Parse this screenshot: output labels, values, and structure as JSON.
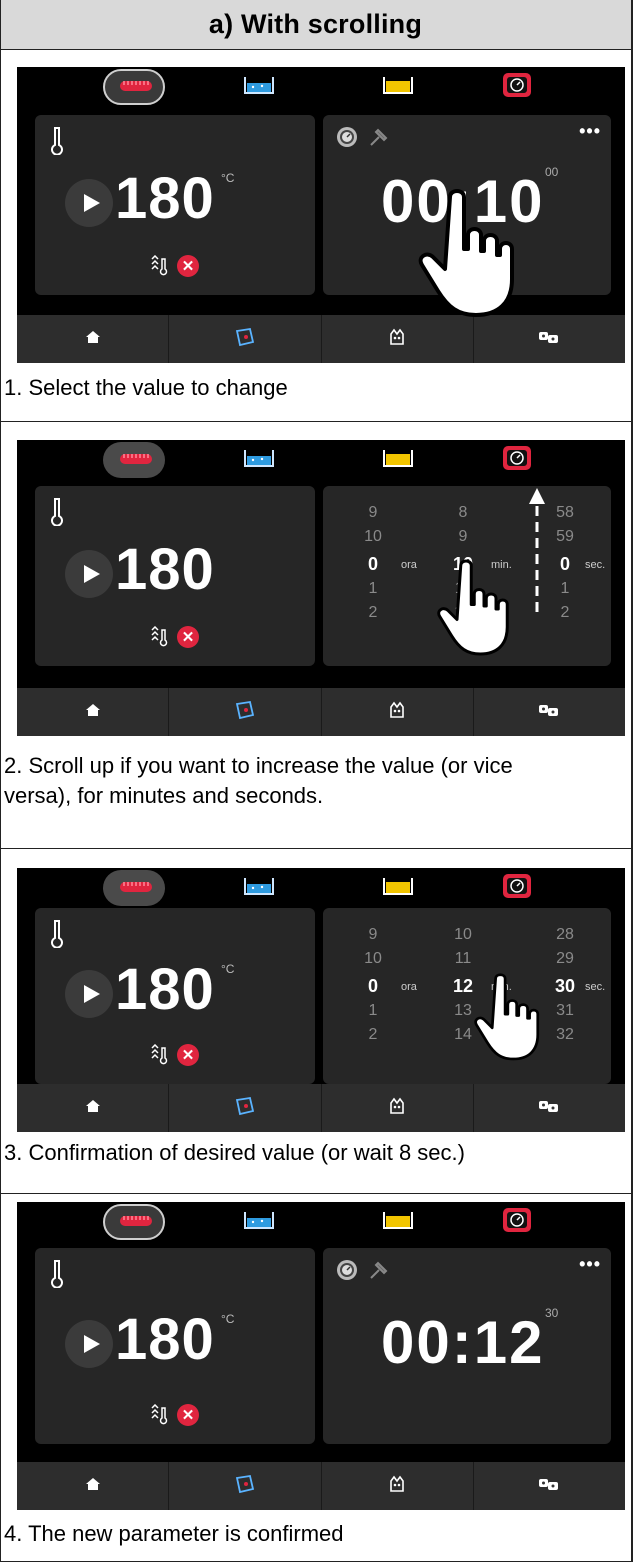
{
  "header": {
    "title": "a)  With scrolling"
  },
  "steps": [
    {
      "caption": "1. Select the value to change"
    },
    {
      "caption": "2. Scroll up if you want to increase the value (or vice versa), for minutes and seconds."
    },
    {
      "caption": "3. Confirmation of desired value (or wait 8 sec.)"
    },
    {
      "caption": "4. The new parameter is confirmed"
    }
  ],
  "screen": {
    "temperature": "180",
    "temp_unit": "°C",
    "icons": {
      "topbar": [
        "grill-pan-icon",
        "water-basin-icon",
        "oil-basin-icon",
        "timer-device-icon"
      ],
      "footer": [
        "home-icon",
        "recipe-book-icon",
        "hand-wash-icon",
        "settings-icon"
      ]
    },
    "timer1": {
      "value": "00:10",
      "seconds": "00"
    },
    "timer4": {
      "value": "00:12",
      "seconds": "30"
    },
    "menu_dots": "•••",
    "x_mark": "✕",
    "wheel2": {
      "hours": [
        "9",
        "10",
        "0",
        "1",
        "2"
      ],
      "minutes": [
        "8",
        "9",
        "10",
        "11",
        "12"
      ],
      "seconds": [
        "58",
        "59",
        "0",
        "1",
        "2"
      ],
      "hour_label": "ora",
      "minute_label": "min.",
      "second_label": "sec."
    },
    "wheel3": {
      "hours": [
        "9",
        "10",
        "0",
        "1",
        "2"
      ],
      "minutes": [
        "10",
        "11",
        "12",
        "13",
        "14"
      ],
      "seconds": [
        "28",
        "29",
        "30",
        "31",
        "32"
      ],
      "hour_label": "ora",
      "minute_label": "min.",
      "second_label": "sec."
    }
  },
  "colors": {
    "accent_red": "#e0253f",
    "oil_yellow": "#f2c500",
    "water_blue": "#2e9be0",
    "screen_bg": "#000000",
    "card_bg": "#262626"
  }
}
